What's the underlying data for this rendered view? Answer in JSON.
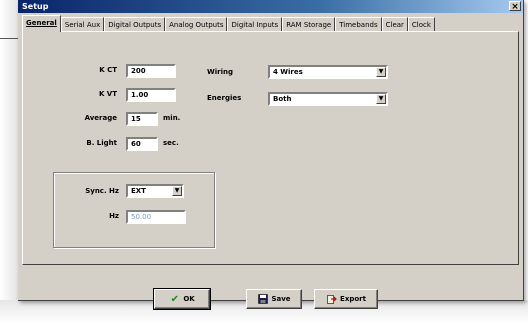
{
  "window": {
    "title": "Setup",
    "close_glyph": "×"
  },
  "tabs": [
    {
      "label": "General",
      "active": true
    },
    {
      "label": "Serial Aux",
      "active": false
    },
    {
      "label": "Digital Outputs",
      "active": false
    },
    {
      "label": "Analog Outputs",
      "active": false
    },
    {
      "label": "Digital Inputs",
      "active": false
    },
    {
      "label": "RAM Storage",
      "active": false
    },
    {
      "label": "Timebands",
      "active": false
    },
    {
      "label": "Clear",
      "active": false
    },
    {
      "label": "Clock",
      "active": false
    }
  ],
  "general": {
    "kct": {
      "label": "K CT",
      "value": "200"
    },
    "kvt": {
      "label": "K VT",
      "value": "1.00"
    },
    "average": {
      "label": "Average",
      "value": "15",
      "unit": "min."
    },
    "blight": {
      "label": "B. Light",
      "value": "60",
      "unit": "sec."
    },
    "wiring": {
      "label": "Wiring",
      "value": "4 Wires"
    },
    "energies": {
      "label": "Energies",
      "value": "Both"
    },
    "sync": {
      "label": "Sync. Hz",
      "value": "EXT",
      "hz_label": "Hz",
      "hz_value": "50.00"
    }
  },
  "buttons": {
    "ok": "OK",
    "save": "Save",
    "export": "Export"
  },
  "icons": {
    "ok": "check-icon",
    "save": "floppy-disk-icon",
    "export": "export-icon"
  },
  "colors": {
    "titlebar_start": "#0a246a",
    "titlebar_end": "#a6caf0",
    "face": "#d4d0c8",
    "check_green": "#1e8c1e"
  }
}
